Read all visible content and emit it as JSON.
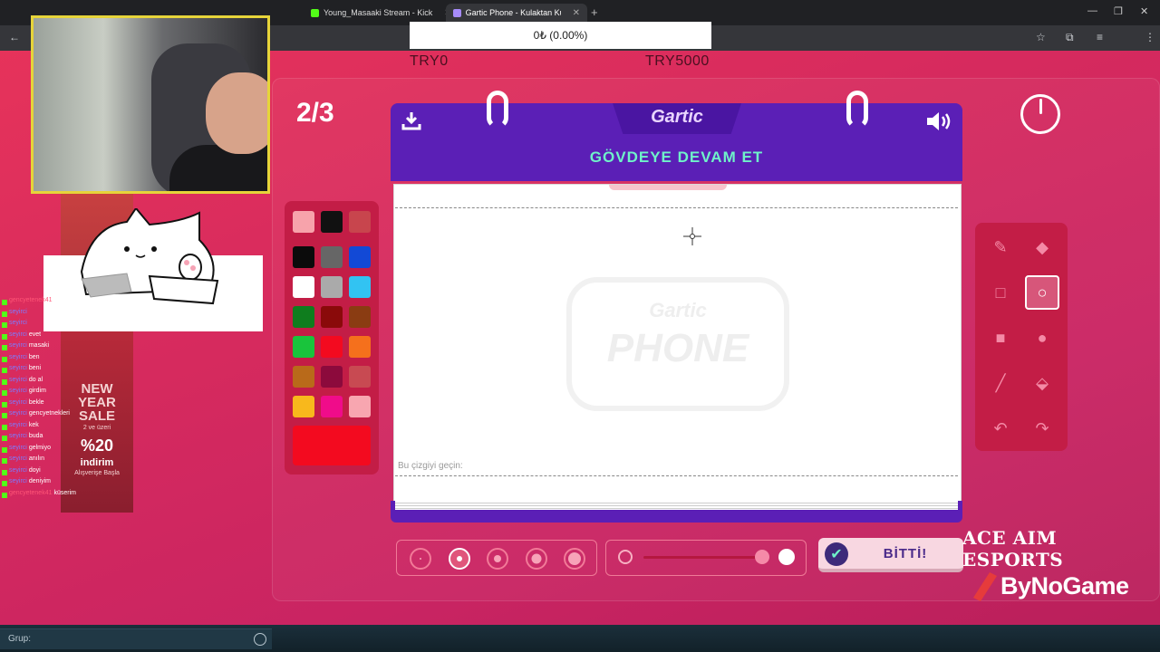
{
  "browser": {
    "tabs": [
      {
        "label": "Young_Masaaki Stream - Kick",
        "active": false
      },
      {
        "label": "Gartic Phone - Kulaktan Kulağa",
        "active": true
      }
    ],
    "new_tab_icon": "plus-icon"
  },
  "donation": {
    "amount": "0₺ (0.00%)",
    "goal_min": "TRY0",
    "goal_max": "TRY5000"
  },
  "game": {
    "round": "2/3",
    "logo": "Gartic",
    "instruction": "GÖVDEYE DEVAM ET",
    "hint": "Bu çizgiyi geçin:",
    "watermark_top": "Gartic",
    "watermark_main": "PHONE",
    "done_button": "BİTTİ!",
    "selected_color": "#f30a1f",
    "palette": [
      "#f7a3ab",
      "#111111",
      "#c8454d",
      "#0b0b0b",
      "#666666",
      "#1249d6",
      "#ffffff",
      "#aaaaaa",
      "#32c3f2",
      "#0f7d1e",
      "#8a0a0a",
      "#8a3c12",
      "#19c43c",
      "#f30a1f",
      "#f5701c",
      "#b96a1a",
      "#8c0a3c",
      "#c84a52",
      "#f8b81c",
      "#f00c8a",
      "#f8a6b0"
    ],
    "tools": [
      "pencil-icon",
      "eraser-icon",
      "rect-outline-icon",
      "ellipse-outline-icon",
      "rect-fill-icon",
      "ellipse-fill-icon",
      "line-icon",
      "bucket-icon",
      "undo-icon",
      "redo-icon"
    ],
    "active_tool": "ellipse-outline-icon",
    "brush_sizes": 5,
    "active_brush_size": 2,
    "opacity": 0.9
  },
  "overlay": {
    "ad_title": "NEW YEAR SALE",
    "ad_sub": "2 ve üzeri",
    "ad_percent": "%20",
    "ad_word": "indirim",
    "ad_cta": "Alışverişe Başla",
    "sponsor_1": "ACE AIM ESPORTS",
    "sponsor_2": "ByNoGame",
    "chat": [
      {
        "user": "gencyetenek41",
        "msg": "hadi",
        "red": true
      },
      {
        "user": "seyirci",
        "msg": "",
        "red": false
      },
      {
        "user": "seyirci",
        "msg": "",
        "red": false
      },
      {
        "user": "seyirci",
        "msg": "evet",
        "red": false
      },
      {
        "user": "seyirci",
        "msg": "masaki",
        "red": false
      },
      {
        "user": "seyirci",
        "msg": "ben",
        "red": false
      },
      {
        "user": "seyirci",
        "msg": "beni",
        "red": false
      },
      {
        "user": "seyirci",
        "msg": "do al",
        "red": false
      },
      {
        "user": "seyirci",
        "msg": "girdim",
        "red": false
      },
      {
        "user": "seyirci",
        "msg": "bekle",
        "red": false
      },
      {
        "user": "seyirci",
        "msg": "gencyetnekleri",
        "red": false
      },
      {
        "user": "seyirci",
        "msg": "kek",
        "red": false
      },
      {
        "user": "seyirci",
        "msg": "buda",
        "red": false
      },
      {
        "user": "seyirci",
        "msg": "gelmiyo",
        "red": false
      },
      {
        "user": "seyirci",
        "msg": "anılın",
        "red": false
      },
      {
        "user": "seyirci",
        "msg": "doyi",
        "red": false
      },
      {
        "user": "seyirci",
        "msg": "deniyim",
        "red": false
      },
      {
        "user": "gencyetenek41",
        "msg": "küserim",
        "red": true
      }
    ]
  },
  "footer": {
    "group_label": "Grup:"
  }
}
